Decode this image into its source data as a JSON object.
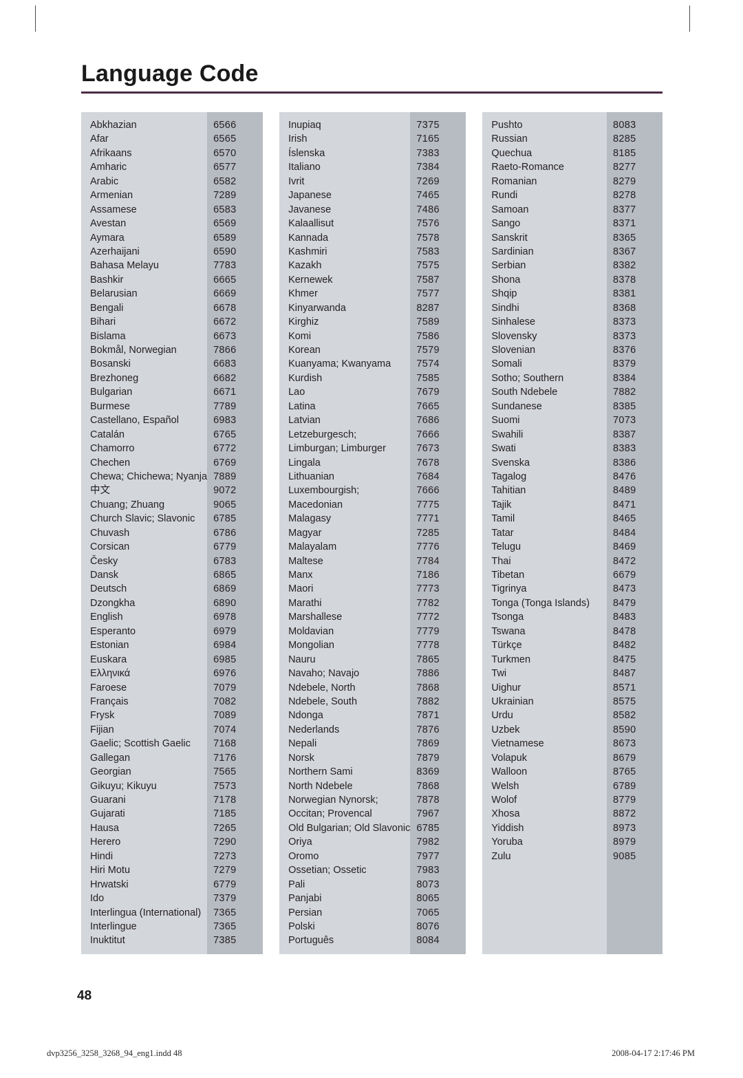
{
  "page": {
    "title": "Language Code",
    "folio": "48",
    "accent_rule_color": "#4b2a46",
    "band_name_color": "#d3d6db",
    "band_code_color": "#b7bbc2"
  },
  "footer": {
    "file_slug": "dvp3256_3258_3268_94_eng1.indd   48",
    "timestamp": "2008-04-17   2:17:46 PM"
  },
  "columns": [
    {
      "rows": [
        {
          "name": "Abkhazian",
          "code": "6566"
        },
        {
          "name": "Afar",
          "code": "6565"
        },
        {
          "name": "Afrikaans",
          "code": "6570"
        },
        {
          "name": "Amharic",
          "code": "6577"
        },
        {
          "name": "Arabic",
          "code": "6582"
        },
        {
          "name": "Armenian",
          "code": "7289"
        },
        {
          "name": "Assamese",
          "code": "6583"
        },
        {
          "name": "Avestan",
          "code": "6569"
        },
        {
          "name": "Aymara",
          "code": "6589"
        },
        {
          "name": "Azerhaijani",
          "code": "6590"
        },
        {
          "name": "Bahasa Melayu",
          "code": "7783"
        },
        {
          "name": "Bashkir",
          "code": "6665"
        },
        {
          "name": "Belarusian",
          "code": "6669"
        },
        {
          "name": "Bengali",
          "code": "6678"
        },
        {
          "name": "Bihari",
          "code": "6672"
        },
        {
          "name": "Bislama",
          "code": "6673"
        },
        {
          "name": "Bokmål, Norwegian",
          "code": "7866"
        },
        {
          "name": "Bosanski",
          "code": "6683"
        },
        {
          "name": "Brezhoneg",
          "code": "6682"
        },
        {
          "name": "Bulgarian",
          "code": "6671"
        },
        {
          "name": "Burmese",
          "code": "7789"
        },
        {
          "name": "Castellano, Español",
          "code": "6983"
        },
        {
          "name": "Catalán",
          "code": "6765"
        },
        {
          "name": "Chamorro",
          "code": "6772"
        },
        {
          "name": "Chechen",
          "code": "6769"
        },
        {
          "name": "Chewa; Chichewa; Nyanja",
          "code": "7889"
        },
        {
          "name": "中文",
          "code": "9072"
        },
        {
          "name": "Chuang; Zhuang",
          "code": "9065"
        },
        {
          "name": "Church Slavic; Slavonic",
          "code": "6785"
        },
        {
          "name": "Chuvash",
          "code": "6786"
        },
        {
          "name": "Corsican",
          "code": "6779"
        },
        {
          "name": "Česky",
          "code": "6783"
        },
        {
          "name": "Dansk",
          "code": "6865"
        },
        {
          "name": "Deutsch",
          "code": "6869"
        },
        {
          "name": "Dzongkha",
          "code": "6890"
        },
        {
          "name": "English",
          "code": "6978"
        },
        {
          "name": "Esperanto",
          "code": "6979"
        },
        {
          "name": "Estonian",
          "code": "6984"
        },
        {
          "name": "Euskara",
          "code": "6985"
        },
        {
          "name": "Ελληνικά",
          "code": "6976"
        },
        {
          "name": "Faroese",
          "code": "7079"
        },
        {
          "name": "Français",
          "code": "7082"
        },
        {
          "name": "Frysk",
          "code": "7089"
        },
        {
          "name": "Fijian",
          "code": "7074"
        },
        {
          "name": "Gaelic; Scottish Gaelic",
          "code": "7168"
        },
        {
          "name": "Gallegan",
          "code": "7176"
        },
        {
          "name": "Georgian",
          "code": "7565"
        },
        {
          "name": "Gikuyu; Kikuyu",
          "code": "7573"
        },
        {
          "name": "Guarani",
          "code": "7178"
        },
        {
          "name": "Gujarati",
          "code": "7185"
        },
        {
          "name": "Hausa",
          "code": "7265"
        },
        {
          "name": "Herero",
          "code": "7290"
        },
        {
          "name": "Hindi",
          "code": "7273"
        },
        {
          "name": "Hiri Motu",
          "code": "7279"
        },
        {
          "name": "Hrwatski",
          "code": "6779"
        },
        {
          "name": "Ido",
          "code": "7379"
        },
        {
          "name": "Interlingua (International)",
          "code": "7365"
        },
        {
          "name": "Interlingue",
          "code": "7365"
        },
        {
          "name": "Inuktitut",
          "code": "7385"
        }
      ]
    },
    {
      "rows": [
        {
          "name": "Inupiaq",
          "code": "7375"
        },
        {
          "name": "Irish",
          "code": "7165"
        },
        {
          "name": "Íslenska",
          "code": "7383"
        },
        {
          "name": "Italiano",
          "code": "7384"
        },
        {
          "name": "Ivrit",
          "code": "7269"
        },
        {
          "name": "Japanese",
          "code": "7465"
        },
        {
          "name": "Javanese",
          "code": "7486"
        },
        {
          "name": "Kalaallisut",
          "code": "7576"
        },
        {
          "name": "Kannada",
          "code": "7578"
        },
        {
          "name": "Kashmiri",
          "code": "7583"
        },
        {
          "name": "Kazakh",
          "code": "7575"
        },
        {
          "name": "Kernewek",
          "code": "7587"
        },
        {
          "name": "Khmer",
          "code": "7577"
        },
        {
          "name": "Kinyarwanda",
          "code": "8287"
        },
        {
          "name": "Kirghiz",
          "code": "7589"
        },
        {
          "name": "Komi",
          "code": "7586"
        },
        {
          "name": "Korean",
          "code": "7579"
        },
        {
          "name": "Kuanyama; Kwanyama",
          "code": "7574"
        },
        {
          "name": "Kurdish",
          "code": "7585"
        },
        {
          "name": "Lao",
          "code": "7679"
        },
        {
          "name": "Latina",
          "code": "7665"
        },
        {
          "name": "Latvian",
          "code": "7686"
        },
        {
          "name": "Letzeburgesch;",
          "code": "7666"
        },
        {
          "name": "Limburgan; Limburger",
          "code": "7673"
        },
        {
          "name": "Lingala",
          "code": "7678"
        },
        {
          "name": "Lithuanian",
          "code": "7684"
        },
        {
          "name": "Luxembourgish;",
          "code": "7666"
        },
        {
          "name": "Macedonian",
          "code": "7775"
        },
        {
          "name": "Malagasy",
          "code": "7771"
        },
        {
          "name": "Magyar",
          "code": "7285"
        },
        {
          "name": "Malayalam",
          "code": "7776"
        },
        {
          "name": "Maltese",
          "code": "7784"
        },
        {
          "name": "Manx",
          "code": "7186"
        },
        {
          "name": "Maori",
          "code": "7773"
        },
        {
          "name": "Marathi",
          "code": "7782"
        },
        {
          "name": "Marshallese",
          "code": "7772"
        },
        {
          "name": "Moldavian",
          "code": "7779"
        },
        {
          "name": "Mongolian",
          "code": "7778"
        },
        {
          "name": "Nauru",
          "code": "7865"
        },
        {
          "name": "Navaho; Navajo",
          "code": "7886"
        },
        {
          "name": "Ndebele, North",
          "code": "7868"
        },
        {
          "name": "Ndebele, South",
          "code": "7882"
        },
        {
          "name": "Ndonga",
          "code": "7871"
        },
        {
          "name": "Nederlands",
          "code": "7876"
        },
        {
          "name": "Nepali",
          "code": "7869"
        },
        {
          "name": "Norsk",
          "code": "7879"
        },
        {
          "name": "Northern Sami",
          "code": "8369"
        },
        {
          "name": "North Ndebele",
          "code": "7868"
        },
        {
          "name": "Norwegian Nynorsk;",
          "code": "7878"
        },
        {
          "name": "Occitan; Provencal",
          "code": "7967"
        },
        {
          "name": "Old Bulgarian; Old Slavonic",
          "code": "6785"
        },
        {
          "name": "Oriya",
          "code": "7982"
        },
        {
          "name": "Oromo",
          "code": "7977"
        },
        {
          "name": "Ossetian; Ossetic",
          "code": "7983"
        },
        {
          "name": "Pali",
          "code": "8073"
        },
        {
          "name": "Panjabi",
          "code": "8065"
        },
        {
          "name": "Persian",
          "code": "7065"
        },
        {
          "name": "Polski",
          "code": "8076"
        },
        {
          "name": "Português",
          "code": "8084"
        }
      ]
    },
    {
      "rows": [
        {
          "name": "Pushto",
          "code": "8083"
        },
        {
          "name": "Russian",
          "code": "8285"
        },
        {
          "name": "Quechua",
          "code": "8185"
        },
        {
          "name": "Raeto-Romance",
          "code": "8277"
        },
        {
          "name": "Romanian",
          "code": "8279"
        },
        {
          "name": "Rundi",
          "code": "8278"
        },
        {
          "name": "Samoan",
          "code": "8377"
        },
        {
          "name": "Sango",
          "code": "8371"
        },
        {
          "name": "Sanskrit",
          "code": "8365"
        },
        {
          "name": "Sardinian",
          "code": "8367"
        },
        {
          "name": "Serbian",
          "code": "8382"
        },
        {
          "name": "Shona",
          "code": "8378"
        },
        {
          "name": "Shqip",
          "code": "8381"
        },
        {
          "name": "Sindhi",
          "code": "8368"
        },
        {
          "name": "Sinhalese",
          "code": "8373"
        },
        {
          "name": "Slovensky",
          "code": "8373"
        },
        {
          "name": "Slovenian",
          "code": "8376"
        },
        {
          "name": "Somali",
          "code": "8379"
        },
        {
          "name": "Sotho; Southern",
          "code": "8384"
        },
        {
          "name": "South Ndebele",
          "code": "7882"
        },
        {
          "name": "Sundanese",
          "code": "8385"
        },
        {
          "name": "Suomi",
          "code": "7073"
        },
        {
          "name": "Swahili",
          "code": "8387"
        },
        {
          "name": "Swati",
          "code": "8383"
        },
        {
          "name": "Svenska",
          "code": "8386"
        },
        {
          "name": "Tagalog",
          "code": "8476"
        },
        {
          "name": "Tahitian",
          "code": "8489"
        },
        {
          "name": "Tajik",
          "code": "8471"
        },
        {
          "name": "Tamil",
          "code": "8465"
        },
        {
          "name": "Tatar",
          "code": "8484"
        },
        {
          "name": "Telugu",
          "code": "8469"
        },
        {
          "name": "Thai",
          "code": "8472"
        },
        {
          "name": "Tibetan",
          "code": "6679"
        },
        {
          "name": "Tigrinya",
          "code": "8473"
        },
        {
          "name": "Tonga (Tonga Islands)",
          "code": "8479"
        },
        {
          "name": "Tsonga",
          "code": "8483"
        },
        {
          "name": "Tswana",
          "code": "8478"
        },
        {
          "name": "Türkçe",
          "code": "8482"
        },
        {
          "name": "Turkmen",
          "code": "8475"
        },
        {
          "name": "Twi",
          "code": "8487"
        },
        {
          "name": "Uighur",
          "code": "8571"
        },
        {
          "name": "Ukrainian",
          "code": "8575"
        },
        {
          "name": "Urdu",
          "code": "8582"
        },
        {
          "name": "Uzbek",
          "code": "8590"
        },
        {
          "name": "Vietnamese",
          "code": "8673"
        },
        {
          "name": "Volapuk",
          "code": "8679"
        },
        {
          "name": "Walloon",
          "code": "8765"
        },
        {
          "name": "Welsh",
          "code": "6789"
        },
        {
          "name": "Wolof",
          "code": "8779"
        },
        {
          "name": "Xhosa",
          "code": "8872"
        },
        {
          "name": "Yiddish",
          "code": "8973"
        },
        {
          "name": "Yoruba",
          "code": "8979"
        },
        {
          "name": "Zulu",
          "code": "9085"
        }
      ]
    }
  ]
}
